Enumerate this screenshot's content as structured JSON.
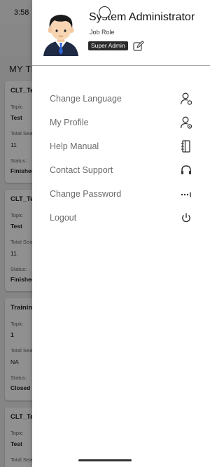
{
  "status_bar": {
    "time": "3:58"
  },
  "background": {
    "section_title": "MY TR",
    "cards": [
      {
        "title": "CLT_Te",
        "topic_label": "Topic",
        "topic_value": "Test",
        "seats_label": "Total Sea",
        "seats_value": "11",
        "status_label": "Status:",
        "status_value": "Finished"
      },
      {
        "title": "CLT_Te",
        "topic_label": "Topic",
        "topic_value": "Test",
        "seats_label": "Total Sea",
        "seats_value": "11",
        "status_label": "Status:",
        "status_value": "Finished"
      },
      {
        "title": "Trainin",
        "topic_label": "Topic",
        "topic_value": "1",
        "seats_label": "Total Sea",
        "seats_value": "NA",
        "status_label": "Status:",
        "status_value": "Closed"
      },
      {
        "title": "CLT_Te",
        "topic_label": "Topic",
        "topic_value": "Test",
        "seats_label": "Total Sea",
        "seats_value": "",
        "status_label": "",
        "status_value": ""
      }
    ]
  },
  "drawer": {
    "user_name": "System Administrator",
    "role_label": "Job Role",
    "badge": "Super Admin",
    "menu": [
      {
        "label": "Change Language",
        "icon": "user-settings-icon"
      },
      {
        "label": "My Profile",
        "icon": "user-profile-icon"
      },
      {
        "label": "Help Manual",
        "icon": "manual-book-icon"
      },
      {
        "label": "Contact Support",
        "icon": "headphones-icon"
      },
      {
        "label": "Change Password",
        "icon": "password-dots-icon"
      },
      {
        "label": "Logout",
        "icon": "power-icon"
      }
    ]
  }
}
